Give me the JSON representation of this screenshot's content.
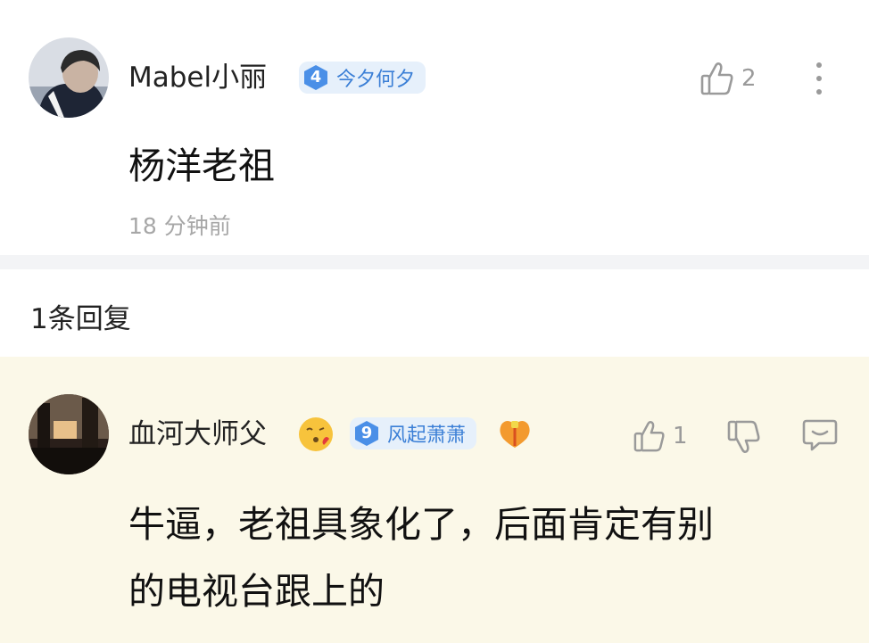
{
  "main_comment": {
    "username": "Mabel小丽",
    "badge_level": "4",
    "badge_text": "今夕何夕",
    "like_count": "2",
    "content": "杨洋老祖",
    "time": "18 分钟前"
  },
  "replies_header": {
    "count_label": "1条回复"
  },
  "reply": {
    "username": "血河大师父",
    "badge_level": "9",
    "badge_text": "风起萧萧",
    "like_count": "1",
    "content_line1": "牛逼，老祖具象化了，后面肯定有别",
    "content_line2": "的电视台跟上的"
  },
  "colors": {
    "badge_blue": "#3b7fd6",
    "badge_bg": "#e6f0fb",
    "reply_bg": "#fbf8e8",
    "muted_gray": "#a7a7a7"
  }
}
